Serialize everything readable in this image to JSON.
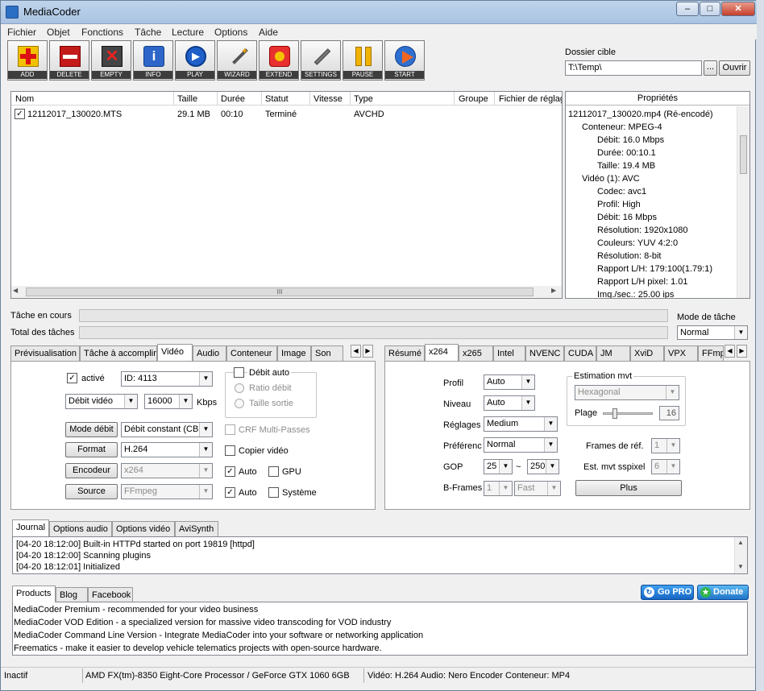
{
  "window": {
    "title": "MediaCoder",
    "controls": [
      "–",
      "□",
      "✕"
    ]
  },
  "menu": [
    "Fichier",
    "Objet",
    "Fonctions",
    "Tâche",
    "Lecture",
    "Options",
    "Aide"
  ],
  "toolbar": [
    {
      "label": "ADD",
      "icon": "add-icon"
    },
    {
      "label": "DELETE",
      "icon": "delete-icon"
    },
    {
      "label": "EMPTY",
      "icon": "empty-icon"
    },
    {
      "label": "INFO",
      "icon": "info-icon"
    },
    {
      "label": "PLAY",
      "icon": "play-icon"
    },
    {
      "label": "WIZARD",
      "icon": "wizard-icon"
    },
    {
      "label": "EXTEND",
      "icon": "extend-icon"
    },
    {
      "label": "SETTINGS",
      "icon": "settings-icon"
    },
    {
      "label": "PAUSE",
      "icon": "pause-icon"
    },
    {
      "label": "START",
      "icon": "start-icon"
    }
  ],
  "target": {
    "label": "Dossier cible",
    "path": "T:\\Temp\\",
    "browse": "...",
    "open": "Ouvrir"
  },
  "filelist": {
    "columns": [
      "Nom",
      "Taille",
      "Durée",
      "Statut",
      "Vitesse",
      "Type",
      "Groupe",
      "Fichier de réglag"
    ],
    "rows": [
      {
        "name": "12112017_130020.MTS",
        "size": "29.1 MB",
        "duration": "00:10",
        "status": "Terminé",
        "speed": "",
        "type": "AVCHD"
      }
    ],
    "scroll_grip": "III"
  },
  "properties": {
    "header": "Propriétés",
    "items": [
      "12112017_130020.mp4 (Ré-encodé)",
      "Conteneur: MPEG-4",
      "Débit: 16.0 Mbps",
      "Durée: 00:10.1",
      "Taille: 19.4 MB",
      "Vidéo (1): AVC",
      "Codec: avc1",
      "Profil: High",
      "Débit: 16 Mbps",
      "Résolution: 1920x1080",
      "Couleurs: YUV 4:2:0",
      "Résolution: 8-bit",
      "Rapport L/H: 179:100(1.79:1)",
      "Rapport L/H pixel: 1.01",
      "Img./sec.: 25.00 ips"
    ]
  },
  "progress": {
    "current_label": "Tâche en cours",
    "total_label": "Total des tâches",
    "mode_label": "Mode de tâche",
    "mode_value": "Normal"
  },
  "left_tabs": [
    "Prévisualisation",
    "Tâche à accomplir",
    "Vidéo",
    "Audio",
    "Conteneur",
    "Image",
    "Son"
  ],
  "video": {
    "enabled_label": "activé",
    "id_value": "ID: 4113",
    "auto_bitrate": "Débit auto",
    "ratio_bitrate": "Ratio débit",
    "output_size": "Taille sortie",
    "bitrate_mode": "Débit vidéo",
    "bitrate_value": "16000",
    "bitrate_unit": "Kbps",
    "mode_button": "Mode débit",
    "mode_value": "Débit constant (CBR",
    "crf_label": "CRF Multi-Passes",
    "format_button": "Format",
    "format_value": "H.264",
    "copy_video": "Copier vidéo",
    "encoder_button": "Encodeur",
    "encoder_value": "x264",
    "auto1": "Auto",
    "gpu": "GPU",
    "source_button": "Source",
    "source_value": "FFmpeg",
    "auto2": "Auto",
    "system": "Système"
  },
  "right_tabs": [
    "Résumé",
    "x264",
    "x265",
    "Intel",
    "NVENC",
    "CUDA",
    "JM",
    "XviD",
    "VPX",
    "FFmp"
  ],
  "x264": {
    "profile_label": "Profil",
    "profile_value": "Auto",
    "level_label": "Niveau",
    "level_value": "Auto",
    "preset_label": "Réglages",
    "preset_value": "Medium",
    "tune_label": "Préférenc",
    "tune_value": "Normal",
    "gop_label": "GOP",
    "gop_min": "25",
    "gop_tilde": "~",
    "gop_max": "250",
    "bframes_label": "B-Frames",
    "bframes_value": "1",
    "bframes_mode": "Fast",
    "me_group": "Estimation mvt",
    "me_value": "Hexagonal",
    "range_label": "Plage",
    "range_value": "16",
    "range_fraction": 0.2,
    "refs_label": "Frames de réf.",
    "refs_value": "1",
    "subme_label": "Est. mvt sspixel",
    "subme_value": "6",
    "more_button": "Plus"
  },
  "log_tabs": [
    "Journal",
    "Options audio",
    "Options vidéo",
    "AviSynth"
  ],
  "log": [
    "[04-20 18:12:00] Built-in HTTPd started on port 19819 [httpd]",
    "[04-20 18:12:00] Scanning plugins",
    "[04-20 18:12:01] Initialized"
  ],
  "news_tabs": [
    "Products",
    "Blog",
    "Facebook"
  ],
  "promo": {
    "gopro": "Go PRO",
    "donate": "Donate"
  },
  "news": [
    "MediaCoder Premium - recommended for your video business",
    "MediaCoder VOD Edition - a specialized version for massive video transcoding for VOD industry",
    "MediaCoder Command Line Version - Integrate MediaCoder into your software or networking application",
    "Freematics - make it easier to develop vehicle telematics projects with open-source hardware."
  ],
  "status": {
    "state": "Inactif",
    "hardware": "AMD FX(tm)-8350 Eight-Core Processor  / GeForce GTX 1060 6GB",
    "summary": "Vidéo: H.264  Audio: Nero Encoder  Conteneur: MP4"
  }
}
